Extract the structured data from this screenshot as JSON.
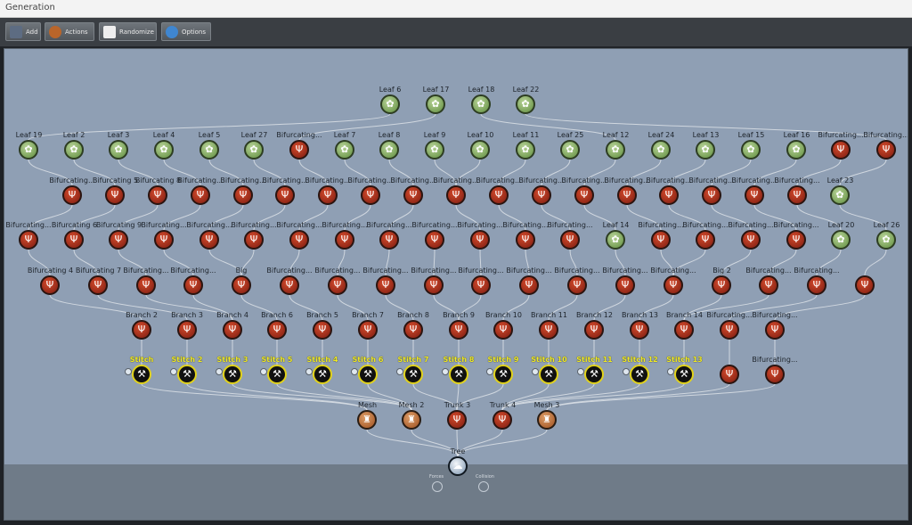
{
  "window": {
    "title": "Generation"
  },
  "toolbar": {
    "buttons": [
      {
        "label": "Add",
        "icon": "add-icon"
      },
      {
        "label": "Actions",
        "icon": "actions-icon"
      },
      {
        "label": "Randomize",
        "icon": "dice-icon"
      },
      {
        "label": "Options",
        "icon": "gear-icon"
      }
    ]
  },
  "graph": {
    "rows": {
      "leafTop": [
        "Leaf 6",
        "Leaf 17",
        "Leaf 18",
        "Leaf 22"
      ],
      "row2": [
        "Leaf 19",
        "Leaf 2",
        "Leaf 3",
        "Leaf 4",
        "Leaf 5",
        "Leaf 27",
        "Bifurcating...",
        "Leaf 7",
        "Leaf 8",
        "Leaf 9",
        "Leaf 10",
        "Leaf 11",
        "Leaf 25",
        "Leaf 12",
        "Leaf 24",
        "Leaf 13",
        "Leaf 15",
        "Leaf 16",
        "Bifurcating...",
        "Bifurcating..."
      ],
      "row3": [
        "Bifurcating...",
        "Bifurcating 5",
        "Bifurcating 8",
        "Bifurcating...",
        "Bifurcating...",
        "Bifurcating...",
        "Bifurcating...",
        "Bifurcating...",
        "Bifurcating...",
        "Bifurcating...",
        "Bifurcating...",
        "Bifurcating...",
        "Bifurcating...",
        "Bifurcating...",
        "Bifurcating...",
        "Bifurcating...",
        "Bifurcating...",
        "Bifurcating...",
        "Leaf 23"
      ],
      "row4": [
        "Bifurcating...",
        "Bifurcating 6",
        "Bifurcating 9",
        "Bifurcating...",
        "Bifurcating...",
        "Bifurcating...",
        "Bifurcating...",
        "Bifurcating...",
        "Bifurcating...",
        "Bifurcating...",
        "Bifurcating...",
        "Bifurcating...",
        "Bifurcating...",
        "Leaf 14",
        "Bifurcating...",
        "Bifurcating...",
        "Bifurcating...",
        "Bifurcating...",
        "Leaf 20",
        "Leaf 26"
      ],
      "row5": [
        "Bifurcating 4",
        "Bifurcating 7",
        "Bifurcating...",
        "Bifurcating...",
        "Big",
        "Bifurcating...",
        "Bifurcating...",
        "Bifurcating...",
        "Bifurcating...",
        "Bifurcating...",
        "Bifurcating...",
        "Bifurcating...",
        "Bifurcating...",
        "Bifurcating...",
        "Big 2",
        "Bifurcating...",
        "Bifurcating...",
        ""
      ],
      "row6": [
        "Branch 2",
        "Branch 3",
        "Branch 4",
        "Branch 6",
        "Branch 5",
        "Branch 7",
        "Branch 8",
        "Branch 9",
        "Branch 10",
        "Branch 11",
        "Branch 12",
        "Branch 13",
        "Branch 14",
        "Bifurcating...",
        "Bifurcating..."
      ],
      "row7": [
        "Stitch",
        "Stitch 2",
        "Stitch 3",
        "Stitch 5",
        "Stitch 4",
        "Stitch 6",
        "Stitch 7",
        "Stitch 8",
        "Stitch 9",
        "Stitch 10",
        "Stitch 11",
        "Stitch 12",
        "Stitch 13",
        "",
        "Bifurcating..."
      ],
      "row8": [
        "Mesh",
        "Mesh 2",
        "Trunk 3",
        "Trunk 4",
        "Mesh 3"
      ],
      "root": "Tree"
    },
    "bottom_icons": [
      {
        "label": "Forces",
        "icon": "forces-icon"
      },
      {
        "label": "Collision",
        "icon": "collision-icon"
      }
    ],
    "colors": {
      "canvas": "#8f9fb4",
      "stitch_label": "#f0ea25",
      "leaf": "#6b9a48",
      "bifurcating": "#b8361f",
      "mesh": "#c07a43"
    }
  }
}
